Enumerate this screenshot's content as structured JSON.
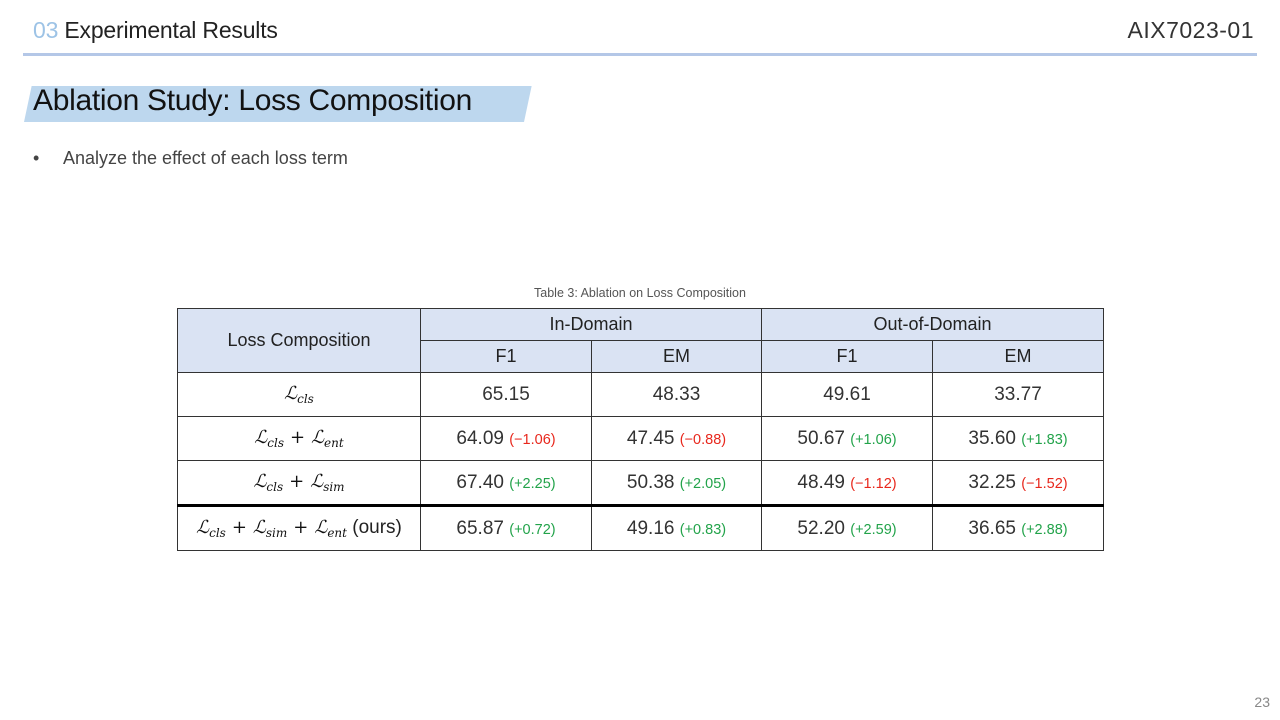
{
  "header": {
    "section_num": "03",
    "section_title": "Experimental Results",
    "course": "AIX7023-01"
  },
  "slide": {
    "title": "Ablation Study: Loss Composition",
    "bullet": "Analyze the effect of each loss term"
  },
  "table": {
    "caption": "Table 3: Ablation on Loss Composition",
    "col_loss": "Loss Composition",
    "group_in": "In-Domain",
    "group_out": "Out-of-Domain",
    "sub": [
      "F1",
      "EM",
      "F1",
      "EM"
    ],
    "rows": [
      {
        "loss": [
          "cls"
        ],
        "suffix": "",
        "cells": [
          {
            "v": "65.15",
            "d": ""
          },
          {
            "v": "48.33",
            "d": ""
          },
          {
            "v": "49.61",
            "d": ""
          },
          {
            "v": "33.77",
            "d": ""
          }
        ]
      },
      {
        "loss": [
          "cls",
          "ent"
        ],
        "suffix": "",
        "cells": [
          {
            "v": "64.09",
            "d": "(−1.06)"
          },
          {
            "v": "47.45",
            "d": "(−0.88)"
          },
          {
            "v": "50.67",
            "d": "(+1.06)"
          },
          {
            "v": "35.60",
            "d": "(+1.83)"
          }
        ]
      },
      {
        "loss": [
          "cls",
          "sim"
        ],
        "suffix": "",
        "cells": [
          {
            "v": "67.40",
            "d": "(+2.25)"
          },
          {
            "v": "50.38",
            "d": "(+2.05)"
          },
          {
            "v": "48.49",
            "d": "(−1.12)"
          },
          {
            "v": "32.25",
            "d": "(−1.52)"
          }
        ]
      },
      {
        "loss": [
          "cls",
          "sim",
          "ent"
        ],
        "suffix": "(ours)",
        "cells": [
          {
            "v": "65.87",
            "d": "(+0.72)"
          },
          {
            "v": "49.16",
            "d": "(+0.83)"
          },
          {
            "v": "52.20",
            "d": "(+2.59)"
          },
          {
            "v": "36.65",
            "d": "(+2.88)"
          }
        ]
      }
    ]
  },
  "colors": {
    "positive": "#22a34a",
    "negative": "#e8271c",
    "header_fill": "#dae3f3",
    "title_fill": "#bdd7ee",
    "accent": "#9dc3e6"
  },
  "page_number": "23"
}
